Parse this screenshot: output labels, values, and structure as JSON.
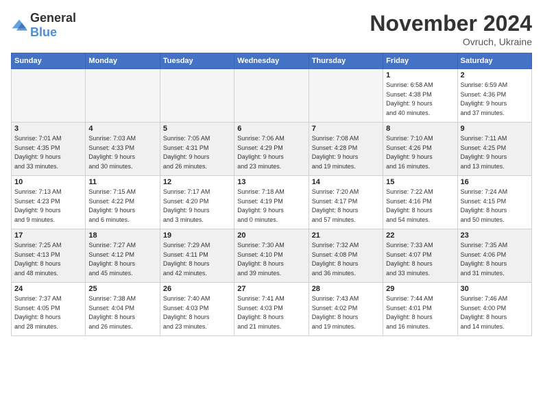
{
  "logo": {
    "general": "General",
    "blue": "Blue"
  },
  "header": {
    "month": "November 2024",
    "location": "Ovruch, Ukraine"
  },
  "days_of_week": [
    "Sunday",
    "Monday",
    "Tuesday",
    "Wednesday",
    "Thursday",
    "Friday",
    "Saturday"
  ],
  "weeks": [
    [
      {
        "day": "",
        "info": ""
      },
      {
        "day": "",
        "info": ""
      },
      {
        "day": "",
        "info": ""
      },
      {
        "day": "",
        "info": ""
      },
      {
        "day": "",
        "info": ""
      },
      {
        "day": "1",
        "info": "Sunrise: 6:58 AM\nSunset: 4:38 PM\nDaylight: 9 hours\nand 40 minutes."
      },
      {
        "day": "2",
        "info": "Sunrise: 6:59 AM\nSunset: 4:36 PM\nDaylight: 9 hours\nand 37 minutes."
      }
    ],
    [
      {
        "day": "3",
        "info": "Sunrise: 7:01 AM\nSunset: 4:35 PM\nDaylight: 9 hours\nand 33 minutes."
      },
      {
        "day": "4",
        "info": "Sunrise: 7:03 AM\nSunset: 4:33 PM\nDaylight: 9 hours\nand 30 minutes."
      },
      {
        "day": "5",
        "info": "Sunrise: 7:05 AM\nSunset: 4:31 PM\nDaylight: 9 hours\nand 26 minutes."
      },
      {
        "day": "6",
        "info": "Sunrise: 7:06 AM\nSunset: 4:29 PM\nDaylight: 9 hours\nand 23 minutes."
      },
      {
        "day": "7",
        "info": "Sunrise: 7:08 AM\nSunset: 4:28 PM\nDaylight: 9 hours\nand 19 minutes."
      },
      {
        "day": "8",
        "info": "Sunrise: 7:10 AM\nSunset: 4:26 PM\nDaylight: 9 hours\nand 16 minutes."
      },
      {
        "day": "9",
        "info": "Sunrise: 7:11 AM\nSunset: 4:25 PM\nDaylight: 9 hours\nand 13 minutes."
      }
    ],
    [
      {
        "day": "10",
        "info": "Sunrise: 7:13 AM\nSunset: 4:23 PM\nDaylight: 9 hours\nand 9 minutes."
      },
      {
        "day": "11",
        "info": "Sunrise: 7:15 AM\nSunset: 4:22 PM\nDaylight: 9 hours\nand 6 minutes."
      },
      {
        "day": "12",
        "info": "Sunrise: 7:17 AM\nSunset: 4:20 PM\nDaylight: 9 hours\nand 3 minutes."
      },
      {
        "day": "13",
        "info": "Sunrise: 7:18 AM\nSunset: 4:19 PM\nDaylight: 9 hours\nand 0 minutes."
      },
      {
        "day": "14",
        "info": "Sunrise: 7:20 AM\nSunset: 4:17 PM\nDaylight: 8 hours\nand 57 minutes."
      },
      {
        "day": "15",
        "info": "Sunrise: 7:22 AM\nSunset: 4:16 PM\nDaylight: 8 hours\nand 54 minutes."
      },
      {
        "day": "16",
        "info": "Sunrise: 7:24 AM\nSunset: 4:15 PM\nDaylight: 8 hours\nand 50 minutes."
      }
    ],
    [
      {
        "day": "17",
        "info": "Sunrise: 7:25 AM\nSunset: 4:13 PM\nDaylight: 8 hours\nand 48 minutes."
      },
      {
        "day": "18",
        "info": "Sunrise: 7:27 AM\nSunset: 4:12 PM\nDaylight: 8 hours\nand 45 minutes."
      },
      {
        "day": "19",
        "info": "Sunrise: 7:29 AM\nSunset: 4:11 PM\nDaylight: 8 hours\nand 42 minutes."
      },
      {
        "day": "20",
        "info": "Sunrise: 7:30 AM\nSunset: 4:10 PM\nDaylight: 8 hours\nand 39 minutes."
      },
      {
        "day": "21",
        "info": "Sunrise: 7:32 AM\nSunset: 4:08 PM\nDaylight: 8 hours\nand 36 minutes."
      },
      {
        "day": "22",
        "info": "Sunrise: 7:33 AM\nSunset: 4:07 PM\nDaylight: 8 hours\nand 33 minutes."
      },
      {
        "day": "23",
        "info": "Sunrise: 7:35 AM\nSunset: 4:06 PM\nDaylight: 8 hours\nand 31 minutes."
      }
    ],
    [
      {
        "day": "24",
        "info": "Sunrise: 7:37 AM\nSunset: 4:05 PM\nDaylight: 8 hours\nand 28 minutes."
      },
      {
        "day": "25",
        "info": "Sunrise: 7:38 AM\nSunset: 4:04 PM\nDaylight: 8 hours\nand 26 minutes."
      },
      {
        "day": "26",
        "info": "Sunrise: 7:40 AM\nSunset: 4:03 PM\nDaylight: 8 hours\nand 23 minutes."
      },
      {
        "day": "27",
        "info": "Sunrise: 7:41 AM\nSunset: 4:03 PM\nDaylight: 8 hours\nand 21 minutes."
      },
      {
        "day": "28",
        "info": "Sunrise: 7:43 AM\nSunset: 4:02 PM\nDaylight: 8 hours\nand 19 minutes."
      },
      {
        "day": "29",
        "info": "Sunrise: 7:44 AM\nSunset: 4:01 PM\nDaylight: 8 hours\nand 16 minutes."
      },
      {
        "day": "30",
        "info": "Sunrise: 7:46 AM\nSunset: 4:00 PM\nDaylight: 8 hours\nand 14 minutes."
      }
    ]
  ]
}
